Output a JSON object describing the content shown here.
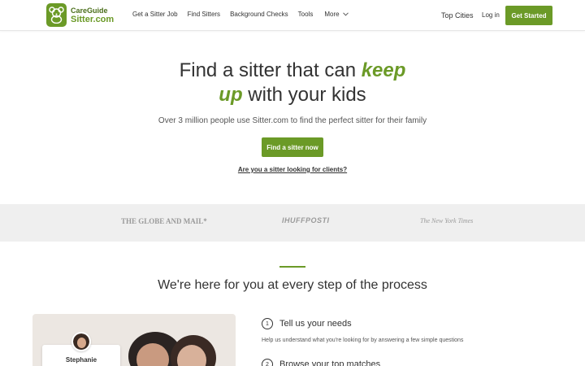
{
  "header": {
    "logo_top": "CareGuide",
    "logo_bottom": "Sitter.com",
    "logo_icon": "bear-icon",
    "nav": [
      {
        "label": "Get a Sitter Job"
      },
      {
        "label": "Find Sitters"
      },
      {
        "label": "Background Checks"
      },
      {
        "label": "Tools"
      },
      {
        "label": "More"
      }
    ],
    "top_cities": "Top Cities",
    "login": "Log in",
    "get_started": "Get Started"
  },
  "hero": {
    "title_part1": "Find a sitter that can ",
    "title_accent1": "keep",
    "title_accent2": "up",
    "title_part2": " with your kids",
    "subtitle": "Over 3 million people use Sitter.com to find the perfect sitter for their family",
    "cta": "Find a sitter now",
    "sitter_link": "Are you a sitter looking for clients?"
  },
  "press": {
    "logos": [
      "THE GLOBE AND MAIL*",
      "IHUFFPOSTI",
      "The New York Times"
    ]
  },
  "process": {
    "title": "We're here for you at every step of the process",
    "card_name": "Stephanie",
    "steps": [
      {
        "num": "1",
        "title": "Tell us your needs",
        "desc": "Help us understand what you're looking for by answering a few simple questions"
      },
      {
        "num": "2",
        "title": "Browse your top matches"
      }
    ]
  },
  "colors": {
    "brand_green": "#6b9a27",
    "press_band": "#efefef"
  }
}
